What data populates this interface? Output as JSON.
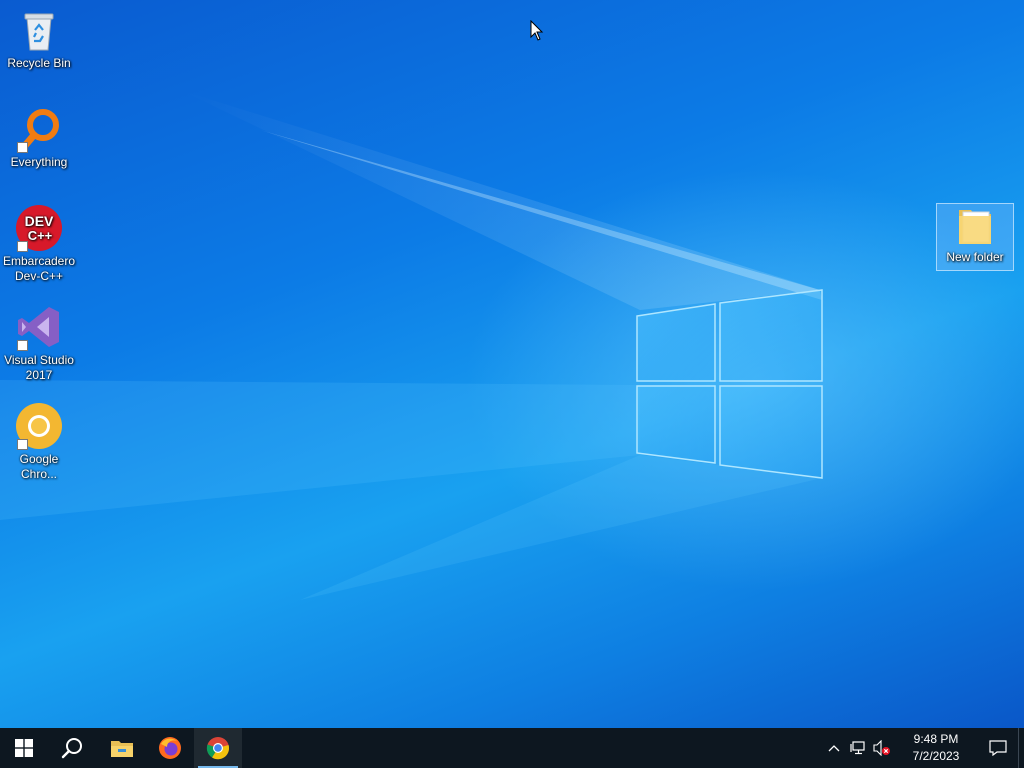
{
  "desktop": {
    "icons": [
      {
        "label": "Recycle Bin",
        "icon": "recycle-bin-icon"
      },
      {
        "label": "Everything",
        "icon": "everything-search-icon"
      },
      {
        "label": "Embarcadero Dev-C++",
        "icon": "dev-cpp-icon",
        "icon_text_1": "DEV",
        "icon_text_2": "C++"
      },
      {
        "label": "Visual Studio 2017",
        "icon": "visual-studio-icon"
      },
      {
        "label": "Google Chro...",
        "icon": "chrome-canary-icon"
      },
      {
        "label": "New folder",
        "icon": "folder-icon",
        "selected": true
      }
    ]
  },
  "taskbar": {
    "start": "windows-start-icon",
    "search": "search-icon",
    "pinned": [
      {
        "name": "File Explorer",
        "icon": "file-explorer-icon"
      },
      {
        "name": "Firefox",
        "icon": "firefox-icon"
      },
      {
        "name": "Google Chrome",
        "icon": "chrome-icon",
        "active": true
      }
    ],
    "tray": {
      "icons": [
        "chevron-up-icon",
        "network-icon",
        "volume-muted-icon"
      ],
      "time": "9:48 PM",
      "date": "7/2/2023",
      "notification": "action-center-icon"
    }
  },
  "colors": {
    "taskbar": "#0d1720",
    "accent": "#76b9ed",
    "desktop": "#0a6fd8"
  }
}
